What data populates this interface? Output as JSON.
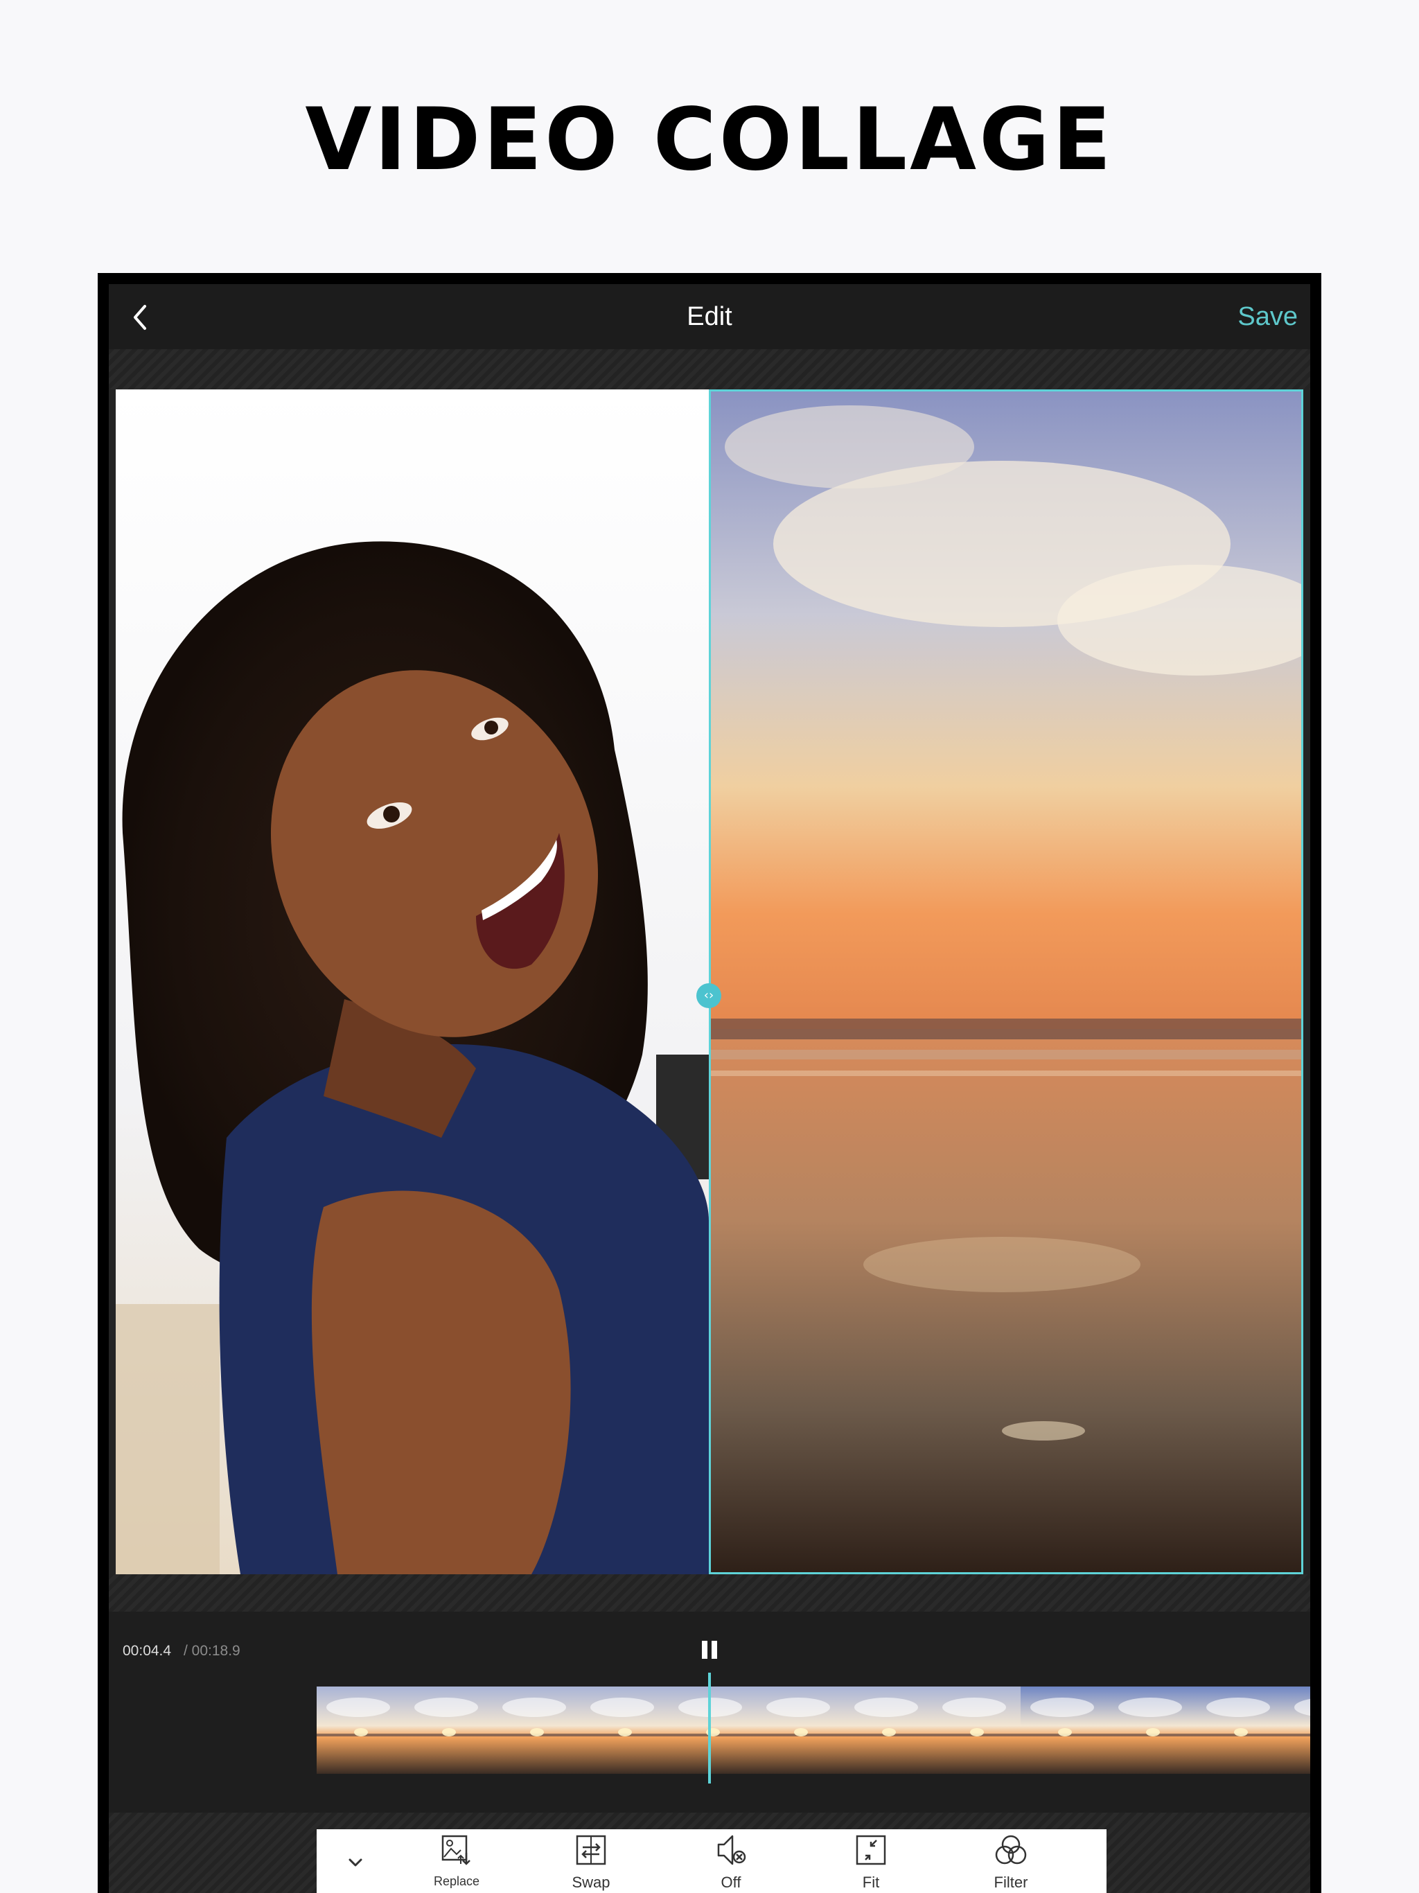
{
  "headline": "VIDEO COLLAGE",
  "navbar": {
    "title": "Edit",
    "save_label": "Save"
  },
  "player": {
    "current_time": "00:04.4",
    "total_time": "/ 00:18.9",
    "frame_count": 12
  },
  "toolbar": {
    "items": [
      {
        "label": "Replace",
        "icon": "replace-icon"
      },
      {
        "label": "Swap",
        "icon": "swap-icon"
      },
      {
        "label": "Off",
        "icon": "sound-off-icon"
      },
      {
        "label": "Fit",
        "icon": "fit-icon"
      },
      {
        "label": "Filter",
        "icon": "filter-icon"
      }
    ]
  },
  "colors": {
    "accent": "#5ed3d8",
    "save": "#5ec8cb",
    "navbar": "#1c1c1c"
  }
}
